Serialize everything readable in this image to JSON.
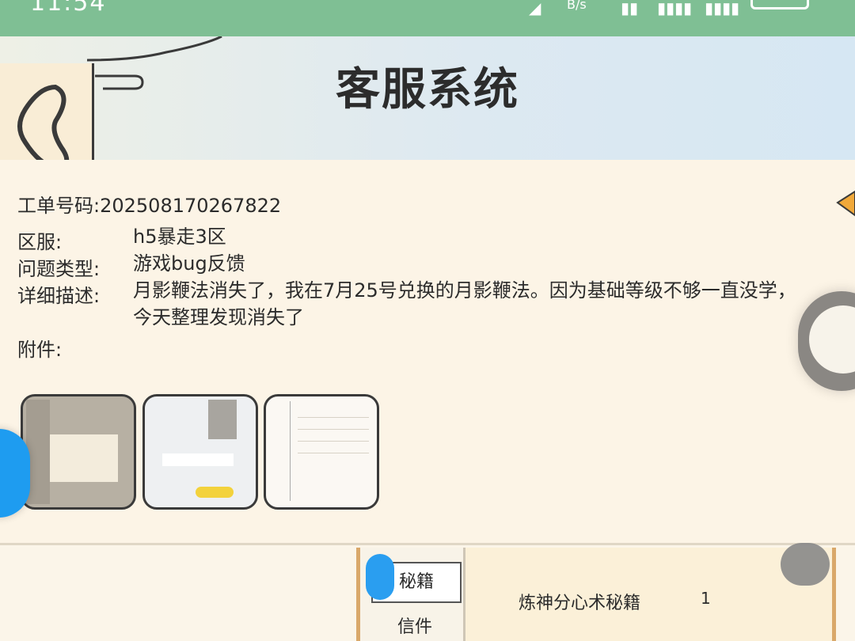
{
  "status_bar": {
    "time": "11:54",
    "net_speed": "B/s"
  },
  "header": {
    "title": "客服系统"
  },
  "ticket": {
    "number_label": "工单号码:",
    "number": "202508170267822",
    "server_label": "区服:",
    "server": "h5暴走3区",
    "type_label": "问题类型:",
    "type": "游戏bug反馈",
    "desc_label": "详细描述:",
    "desc": "月影鞭法消失了，我在7月25号兑换的月影鞭法。因为基础等级不够一直没学，今天整理发现消失了",
    "attach_label": "附件:"
  },
  "bottom_panel": {
    "tab_active": "秘籍",
    "tab_2": "信件",
    "item_name": "炼神分心术秘籍",
    "item_qty": "1"
  },
  "colors": {
    "status_bar": "#7fbf94",
    "card_bg": "#fcf4e6",
    "accent_blue": "#1e9cf0",
    "arrow_orange": "#f1a93a"
  },
  "icons": [
    "back-arrow-icon",
    "side-arrow-icon",
    "float-assistant-icon",
    "float-support-icon"
  ]
}
